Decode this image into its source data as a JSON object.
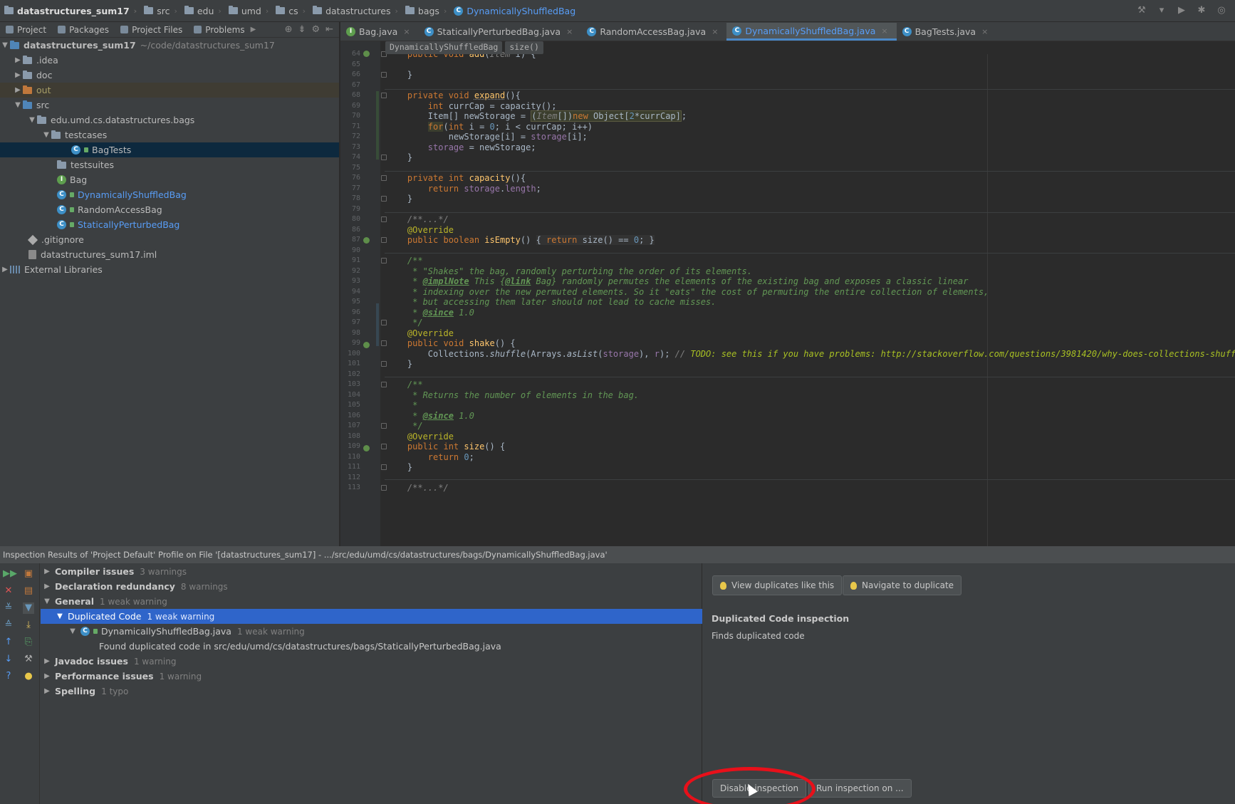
{
  "breadcrumb": {
    "items": [
      "datastructures_sum17",
      "src",
      "edu",
      "umd",
      "cs",
      "datastructures",
      "bags",
      "DynamicallyShuffledBag"
    ]
  },
  "project_panel": {
    "tabs": [
      "Project",
      "Packages",
      "Project Files",
      "Problems"
    ]
  },
  "tree": {
    "root": "datastructures_sum17",
    "root_path": "~/code/datastructures_sum17",
    "idea": ".idea",
    "doc": "doc",
    "out": "out",
    "src": "src",
    "package": "edu.umd.cs.datastructures.bags",
    "testcases": "testcases",
    "bagtests": "BagTests",
    "testsuites": "testsuites",
    "bag": "Bag",
    "dyn": "DynamicallyShuffledBag",
    "random": "RandomAccessBag",
    "static": "StaticallyPerturbedBag",
    "gitignore": ".gitignore",
    "iml": "datastructures_sum17.iml",
    "extlib": "External Libraries"
  },
  "editor_tabs": [
    "Bag.java",
    "StaticallyPerturbedBag.java",
    "RandomAccessBag.java",
    "DynamicallyShuffledBag.java",
    "BagTests.java"
  ],
  "editor_breadcrumb": [
    "DynamicallyShuffledBag",
    "size()"
  ],
  "line_numbers": [
    "64",
    "65",
    "66",
    "67",
    "68",
    "69",
    "70",
    "71",
    "72",
    "73",
    "74",
    "75",
    "76",
    "77",
    "78",
    "79",
    "80",
    "86",
    "87",
    "90",
    "91",
    "92",
    "93",
    "94",
    "95",
    "96",
    "97",
    "98",
    "99",
    "100",
    "101",
    "102",
    "103",
    "104",
    "105",
    "106",
    "107",
    "108",
    "109",
    "110",
    "111",
    "112",
    "113"
  ],
  "inspection": {
    "title": "Inspection Results of 'Project Default' Profile on File '[datastructures_sum17] - .../src/edu/umd/cs/datastructures/bags/DynamicallyShuffledBag.java'",
    "groups": [
      {
        "name": "Compiler issues",
        "count": "3 warnings"
      },
      {
        "name": "Declaration redundancy",
        "count": "8 warnings"
      },
      {
        "name": "General",
        "count": "1 weak warning"
      },
      {
        "name": "Duplicated Code",
        "count": "1 weak warning"
      },
      {
        "name": "DynamicallyShuffledBag.java",
        "count": "1 weak warning"
      },
      {
        "name": "Found duplicated code in src/edu/umd/cs/datastructures/bags/StaticallyPerturbedBag.java",
        "count": ""
      },
      {
        "name": "Javadoc issues",
        "count": "1 warning"
      },
      {
        "name": "Performance issues",
        "count": "1 warning"
      },
      {
        "name": "Spelling",
        "count": "1 typo"
      }
    ],
    "detail": {
      "view_duplicates": "View duplicates like this",
      "navigate_duplicate": "Navigate to duplicate",
      "title": "Duplicated Code inspection",
      "description": "Finds duplicated code",
      "disable": "Disable inspection",
      "run": "Run inspection on ..."
    }
  },
  "colors": {
    "accent": "#589df6",
    "selection": "#2f65ca",
    "highlight_ring": "#e8101a"
  }
}
